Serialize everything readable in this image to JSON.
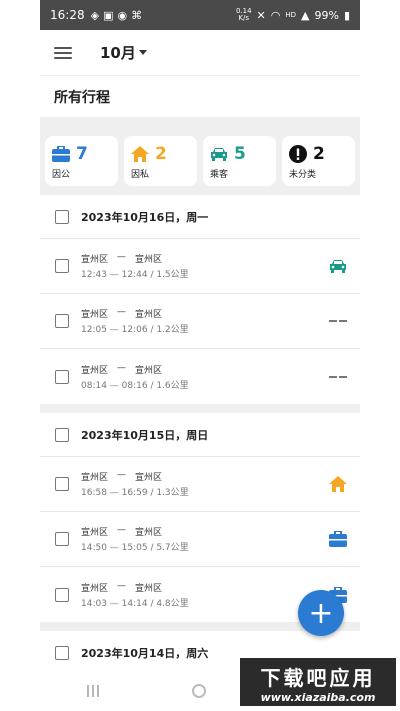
{
  "status_bar": {
    "time": "16:28",
    "speed_value": "0.14",
    "speed_unit": "K/s",
    "network": "HD",
    "battery": "99%"
  },
  "header": {
    "month": "10月"
  },
  "section_title": "所有行程",
  "categories": [
    {
      "count": "7",
      "label": "因公",
      "color": "#2a7bd1",
      "icon": "briefcase-icon"
    },
    {
      "count": "2",
      "label": "因私",
      "color": "#f5a623",
      "icon": "home-icon"
    },
    {
      "count": "5",
      "label": "乘客",
      "color": "#1a9a8a",
      "icon": "car-icon"
    },
    {
      "count": "2",
      "label": "未分类",
      "color": "#111111",
      "icon": "exclamation-icon"
    }
  ],
  "days": [
    {
      "date": "2023年10月16日，周一",
      "trips": [
        {
          "from": "宣州区",
          "sep": "—",
          "to": "宣州区",
          "meta": "12:43 — 12:44 / 1.5公里",
          "icon": "car-icon"
        },
        {
          "from": "宣州区",
          "sep": "—",
          "to": "宣州区",
          "meta": "12:05 — 12:06 / 1.2公里",
          "icon": "unclassified-dash-icon"
        },
        {
          "from": "宣州区",
          "sep": "—",
          "to": "宣州区",
          "meta": "08:14 — 08:16 / 1.6公里",
          "icon": "unclassified-dash-icon"
        }
      ]
    },
    {
      "date": "2023年10月15日，周日",
      "trips": [
        {
          "from": "宣州区",
          "sep": "—",
          "to": "宣州区",
          "meta": "16:58 — 16:59 / 1.3公里",
          "icon": "home-icon"
        },
        {
          "from": "宣州区",
          "sep": "—",
          "to": "宣州区",
          "meta": "14:50 — 15:05 / 5.7公里",
          "icon": "briefcase-icon"
        },
        {
          "from": "宣州区",
          "sep": "—",
          "to": "宣州区",
          "meta": "14:03 — 14:14 / 4.8公里",
          "icon": "briefcase-icon"
        }
      ]
    },
    {
      "date": "2023年10月14日，周六",
      "trips": []
    }
  ],
  "fab_label": "+",
  "watermark": {
    "title": "下载吧应用",
    "url": "www.xiazaiba.com"
  }
}
